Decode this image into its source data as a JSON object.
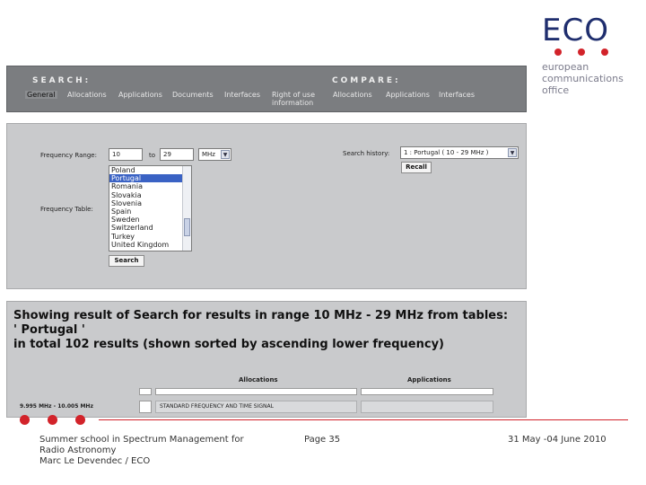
{
  "logo": {
    "word": "ECO",
    "tagline": [
      "european",
      "communications",
      "office"
    ],
    "dot_color": "#d2232a",
    "text_color": "#1f2e6e"
  },
  "nav": {
    "search_heading": "SEARCH:",
    "compare_heading": "COMPARE:",
    "search_items": [
      "General",
      "Allocations",
      "Applications",
      "Documents",
      "Interfaces",
      "Right of use information"
    ],
    "compare_items": [
      "Allocations",
      "Applications",
      "Interfaces"
    ]
  },
  "search": {
    "frequency_range_label": "Frequency Range:",
    "from_value": "10",
    "to_label": "to",
    "to_value": "29",
    "unit_value": "MHz",
    "search_history_label": "Search history:",
    "search_history_value": "1 : Portugal ( 10 - 29 MHz )",
    "recall_label": "Recall",
    "frequency_table_label": "Frequency Table:",
    "tables": [
      "Poland",
      "Portugal",
      "Romania",
      "Slovakia",
      "Slovenia",
      "Spain",
      "Sweden",
      "Switzerland",
      "Turkey",
      "United Kingdom"
    ],
    "selected_table": "Portugal",
    "search_button_label": "Search"
  },
  "results": {
    "line1": "Showing result of Search for results in range 10 MHz - 29 MHz from tables:",
    "line2": "' Portugal '",
    "line3": "in total 102 results (shown sorted by ascending lower frequency)",
    "col_allocations": "Allocations",
    "col_applications": "Applications",
    "rows": [
      {
        "range": "9.995 MHz - 10.005 MHz",
        "allocation": "STANDARD FREQUENCY AND TIME SIGNAL"
      }
    ]
  },
  "footer": {
    "left_lines": [
      "Summer school in Spectrum Management for",
      "Radio Astronomy",
      "Marc Le Devendec / ECO"
    ],
    "page": "Page 35",
    "date": "31 May -04 June 2010"
  }
}
